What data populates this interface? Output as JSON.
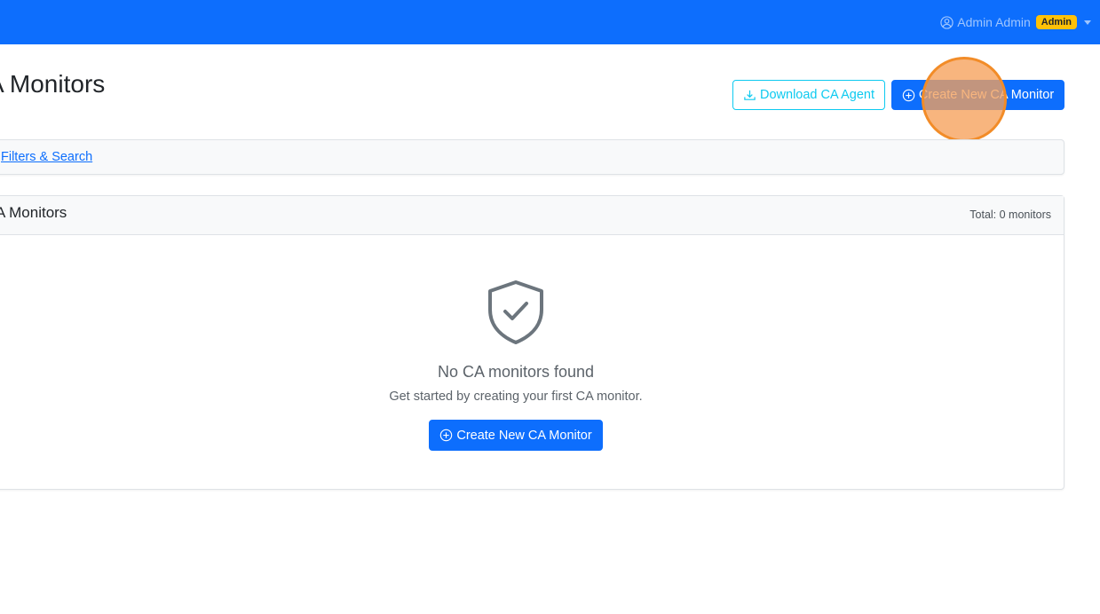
{
  "header": {
    "user_name": "Admin Admin",
    "role_badge": "Admin"
  },
  "page": {
    "title": "A Monitors"
  },
  "actions": {
    "download_label": "Download CA Agent",
    "create_label": "Create New CA Monitor"
  },
  "filters": {
    "toggle_label": "Filters & Search"
  },
  "monitors_card": {
    "title": "A Monitors",
    "total_label": "Total: 0 monitors"
  },
  "empty_state": {
    "title": "No CA monitors found",
    "description": "Get started by creating your first CA monitor.",
    "button_label": "Create New CA Monitor"
  },
  "colors": {
    "primary": "#0d6efd",
    "info": "#0dcaf0",
    "warning": "#ffc107"
  },
  "icons": [
    "user-circle-icon",
    "caret-down-icon",
    "download-icon",
    "plus-circle-icon",
    "shield-check-icon"
  ]
}
